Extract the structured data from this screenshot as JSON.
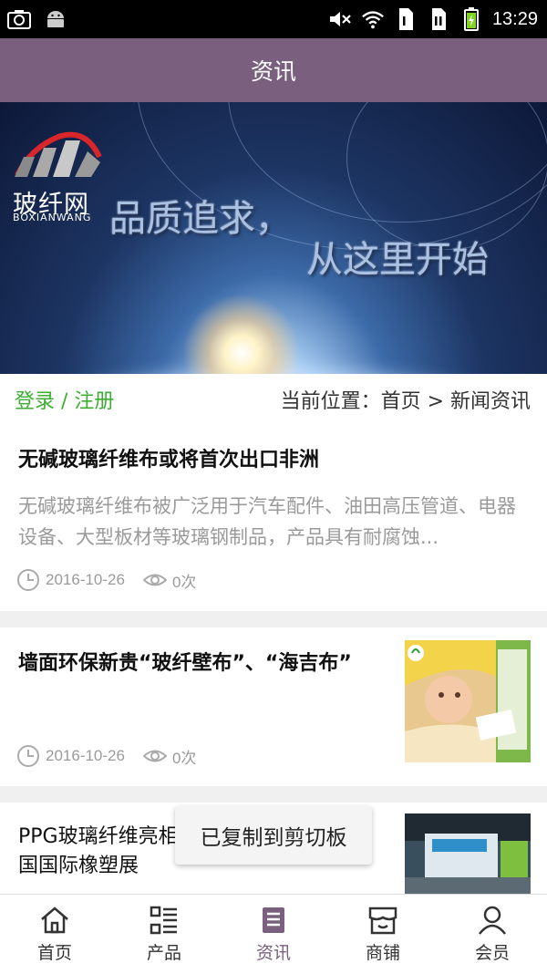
{
  "status_bar": {
    "time": "13:29",
    "icons": [
      "screenshot-icon",
      "android-icon",
      "mute-icon",
      "wifi-icon",
      "sim1-icon",
      "sim2-icon",
      "battery-icon"
    ]
  },
  "header": {
    "title": "资讯"
  },
  "banner": {
    "logo_cn": "玻纤网",
    "logo_en": "BOXIANWANG",
    "slogan_line1": "品质追求，",
    "slogan_line2": "从这里开始"
  },
  "breadcrumb": {
    "login_label": "登录 / 注册",
    "location": "当前位置：首页 > 新闻资讯"
  },
  "articles": [
    {
      "title": "无碱玻璃纤维布或将首次出口非洲",
      "summary": "无碱玻璃纤维布被广泛用于汽车配件、油田高压管道、电器设备、大型板材等玻璃钢制品，产品具有耐腐蚀...",
      "date": "2016-10-26",
      "views": "0次"
    },
    {
      "title": "墙面环保新贵“玻纤壁布”、“海吉布”",
      "date": "2016-10-26",
      "views": "0次"
    },
    {
      "title": "PPG玻璃纤维亮相CHINAPLAS2015中国国际橡塑展"
    }
  ],
  "toast": {
    "text": "已复制到剪切板"
  },
  "bottom_nav": [
    {
      "label": "首页",
      "icon": "home-icon"
    },
    {
      "label": "产品",
      "icon": "list-icon"
    },
    {
      "label": "资讯",
      "icon": "news-icon",
      "active": true
    },
    {
      "label": "商铺",
      "icon": "shop-icon"
    },
    {
      "label": "会员",
      "icon": "user-icon"
    }
  ],
  "colors": {
    "header_bg": "#7a5f7f",
    "login_green": "#3cae32",
    "active_nav": "#7a5f7f"
  }
}
